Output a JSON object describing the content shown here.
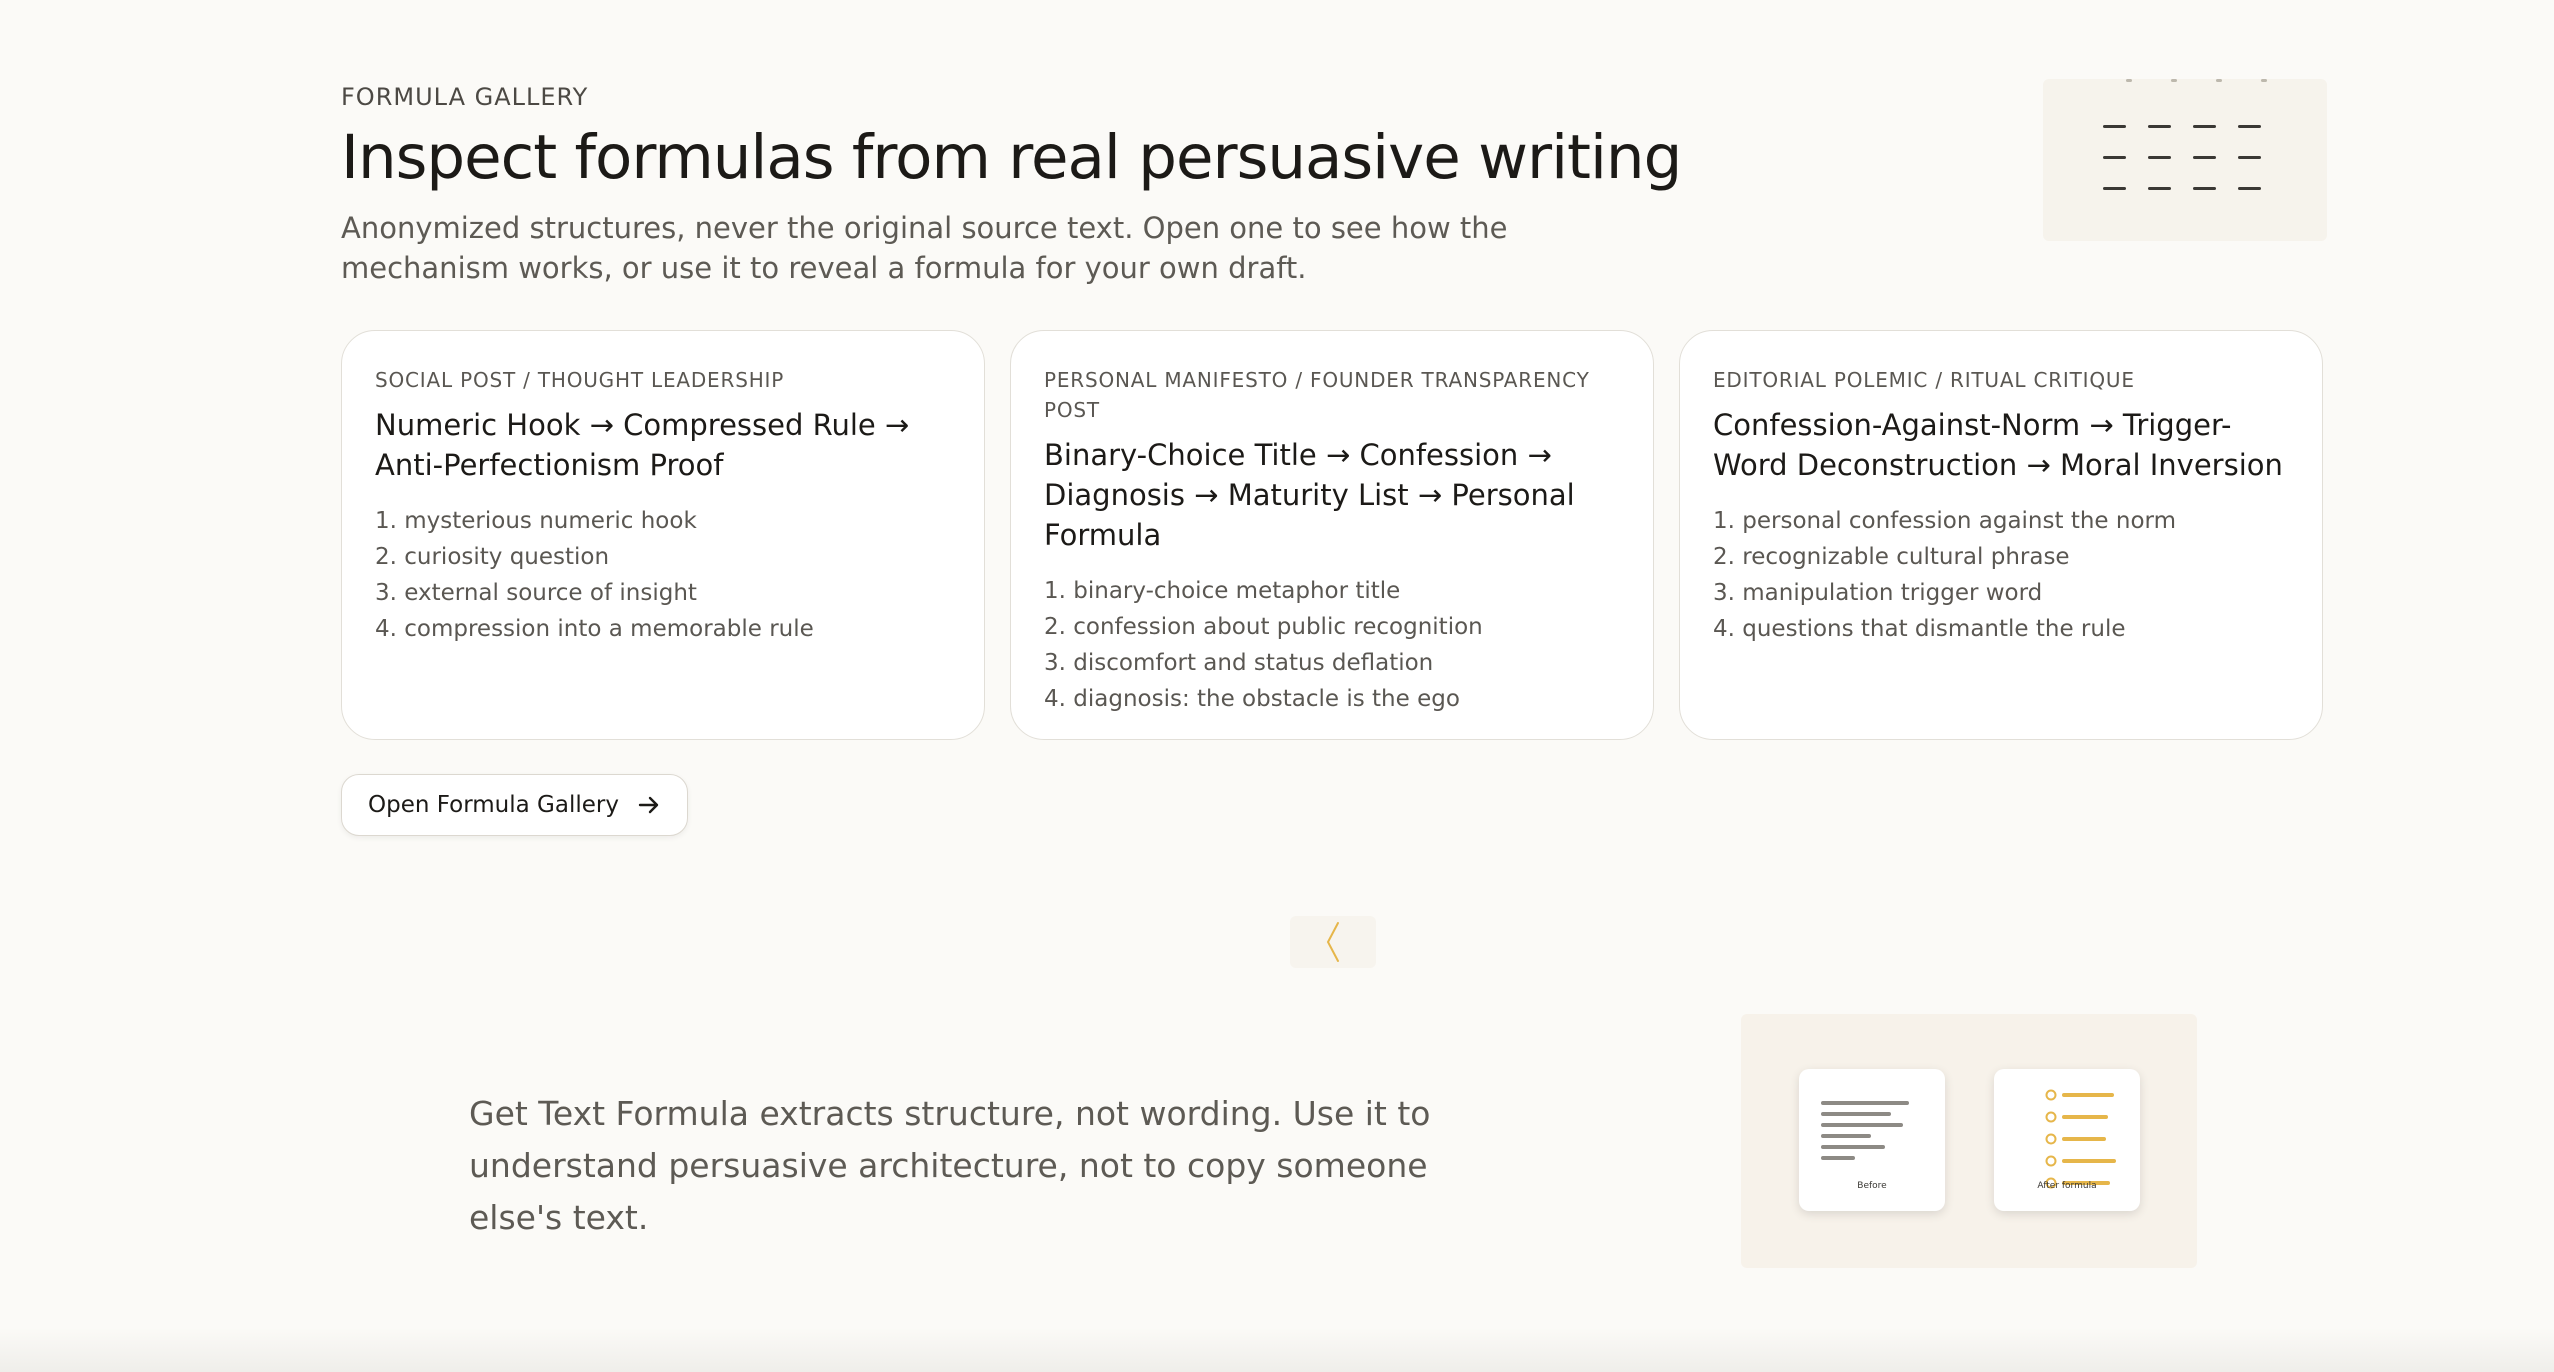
{
  "header": {
    "eyebrow": "FORMULA GALLERY",
    "title": "Inspect formulas from real persuasive writing",
    "intro": "Anonymized structures, never the original source text. Open one to see how the mechanism works, or use it to reveal a formula for your own draft."
  },
  "cards": [
    {
      "category": "SOCIAL POST / THOUGHT LEADERSHIP",
      "title": "Numeric Hook → Compressed Rule → Anti-Perfectionism Proof",
      "steps": [
        "1. mysterious numeric hook",
        "2. curiosity question",
        "3. external source of insight",
        "4. compression into a memorable rule"
      ]
    },
    {
      "category": "PERSONAL MANIFESTO / FOUNDER TRANSPARENCY POST",
      "title": "Binary-Choice Title → Confession → Diagnosis → Maturity List → Personal Formula",
      "steps": [
        "1. binary-choice metaphor title",
        "2. confession about public recognition",
        "3. discomfort and status deflation",
        "4. diagnosis: the obstacle is the ego"
      ]
    },
    {
      "category": "EDITORIAL POLEMIC / RITUAL CRITIQUE",
      "title": "Confession-Against-Norm → Trigger-Word Deconstruction → Moral Inversion",
      "steps": [
        "1. personal confession against the norm",
        "2. recognizable cultural phrase",
        "3. manipulation trigger word",
        "4. questions that dismantle the rule"
      ]
    }
  ],
  "gallery_button": {
    "label": "Open Formula Gallery",
    "icon": "arrow-right-icon"
  },
  "divider_icon": "chevron-left-icon",
  "note": "Get Text Formula extracts structure, not wording. Use it to understand persuasive architecture, not to copy someone else's text.",
  "illustration": {
    "before_label": "Before",
    "after_label": "After formula"
  },
  "colors": {
    "background": "#fbfaf7",
    "accent": "#e6b64a",
    "text": "#1c1a17",
    "muted": "#5d5a54"
  }
}
